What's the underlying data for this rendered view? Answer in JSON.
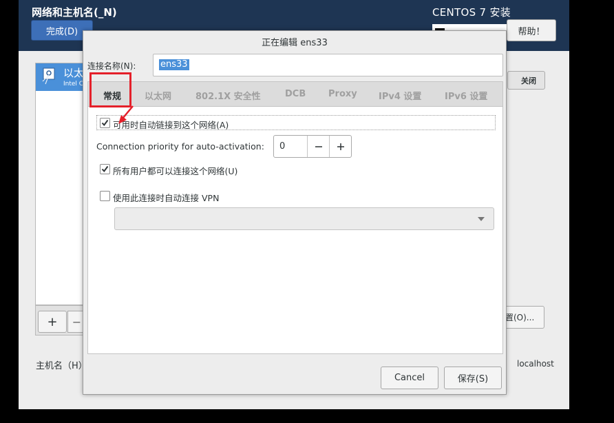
{
  "header": {
    "title": "网络和主机名(_N)",
    "done_label": "完成(D)",
    "product": "CENTOS 7 安装",
    "help_label": "帮助！"
  },
  "device": {
    "name": "以太",
    "sub": "Intel C"
  },
  "list_toolbar": {
    "add": "+",
    "remove": "−"
  },
  "switch_label": "关闭",
  "configure_label": "置(O)...",
  "hostname_label": "主机名（H）",
  "current_host": "localhost",
  "dialog": {
    "title": "正在编辑 ens33",
    "conn_name_label": "连接名称(N):",
    "conn_name_value": "ens33",
    "tabs": [
      "常规",
      "以太网",
      "802.1X 安全性",
      "DCB",
      "Proxy",
      "IPv4 设置",
      "IPv6 设置"
    ],
    "general": {
      "auto_connect_label": "可用时自动链接到这个网络(A)",
      "auto_connect_checked": true,
      "priority_label": "Connection priority for auto-activation:",
      "priority_value": "0",
      "all_users_label": "所有用户都可以连接这个网络(U)",
      "all_users_checked": true,
      "vpn_label": "使用此连接时自动连接 VPN",
      "vpn_checked": false,
      "vpn_select_value": ""
    },
    "cancel_label": "Cancel",
    "save_label": "保存(S)"
  },
  "colors": {
    "topbar": "#1e3553",
    "accent": "#4a90d9",
    "annotation": "#e4202a"
  }
}
